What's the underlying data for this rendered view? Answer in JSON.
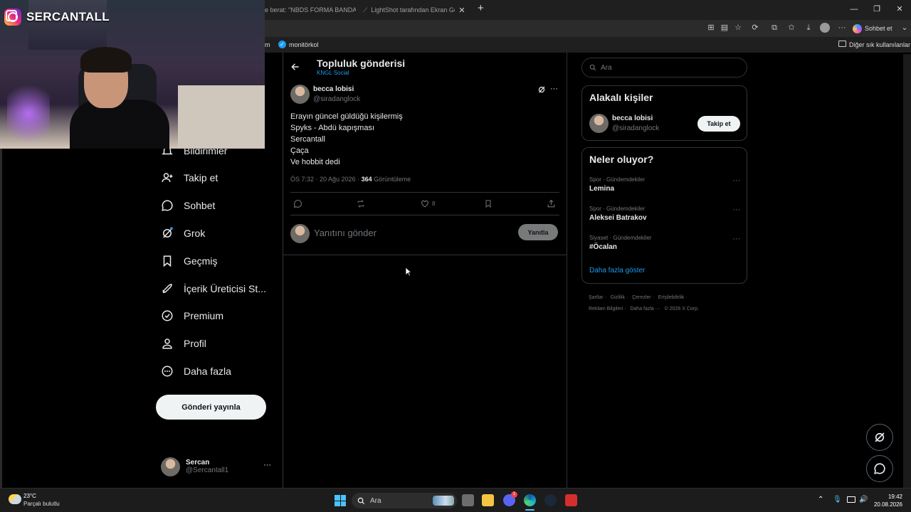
{
  "browser": {
    "tabs": [
      {
        "label": "e berat: \"NBDS FORMA BANDA",
        "close": "✕"
      },
      {
        "label": "LightShot tarafından Ekran Görün",
        "close": "✕"
      }
    ],
    "new_tab": "+",
    "sohbet_label": "Sohbet et",
    "bookmarks": {
      "left": "m",
      "monitorkol": "monitörkol",
      "other": "Diğer sık kullanılanlar"
    }
  },
  "overlay": {
    "streamer_handle": "SERCANTALL"
  },
  "nav": {
    "items": [
      {
        "label": "Bildirimler",
        "icon": "bell-icon"
      },
      {
        "label": "Takip et",
        "icon": "follow-icon"
      },
      {
        "label": "Sohbet",
        "icon": "chat-icon"
      },
      {
        "label": "Grok",
        "icon": "grok-icon"
      },
      {
        "label": "Geçmiş",
        "icon": "bookmark-icon"
      },
      {
        "label": "İçerik Üreticisi St...",
        "icon": "rocket-icon"
      },
      {
        "label": "Premium",
        "icon": "verified-icon"
      },
      {
        "label": "Profil",
        "icon": "person-icon"
      },
      {
        "label": "Daha fazla",
        "icon": "more-circle-icon"
      }
    ],
    "post_button": "Gönderi yayınla",
    "profile": {
      "name": "Sercan",
      "handle": "@Sercantall1",
      "more": "···"
    }
  },
  "post": {
    "header_title": "Topluluk gönderisi",
    "community": "KNGL Social",
    "author_name": "becca lobisi",
    "author_handle": "@siradanglock",
    "lines": [
      "Erayın güncel güldüğü kişilermiş",
      "Spyks - Abdü kapışması",
      "Sercantall",
      "Çaça",
      "Ve hobbit dedi"
    ],
    "meta_time": "ÖS 7:32 · 20 Ağu 2026 · ",
    "views_count": "364",
    "views_label": " Görüntüleme",
    "likes": "8",
    "reply_placeholder": "Yanıtını gönder",
    "reply_button": "Yanıtla"
  },
  "sidebar": {
    "search_placeholder": "Ara",
    "related_title": "Alakalı kişiler",
    "related_user": {
      "name": "becca lobisi",
      "handle": "@siradanglock",
      "follow": "Takip et"
    },
    "trends_title": "Neler oluyor?",
    "trends": [
      {
        "category": "Spor · Gündemdekiler",
        "name": "Lemina"
      },
      {
        "category": "Spor · Gündemdekiler",
        "name": "Aleksei Batrakov"
      },
      {
        "category": "Siyaset · Gündemdekiler",
        "name": "#Öcalan"
      }
    ],
    "show_more": "Daha fazla göster",
    "footer": {
      "row1": [
        "Şartlar",
        "Gizlilik",
        "Çerezler",
        "Erişilebilirlik"
      ],
      "row2": [
        "Reklam Bilgileri",
        "Daha fazla ···",
        "© 2026 X Corp."
      ]
    }
  },
  "taskbar": {
    "weather_temp": "23°C",
    "weather_desc": "Parçalı bulutlu",
    "search": "Ara",
    "time": "19:42",
    "date": "20.08.2026",
    "discord_badge": "1"
  },
  "colors": {
    "accent": "#1d9bf0",
    "background": "#000000",
    "border": "#2f3336"
  }
}
